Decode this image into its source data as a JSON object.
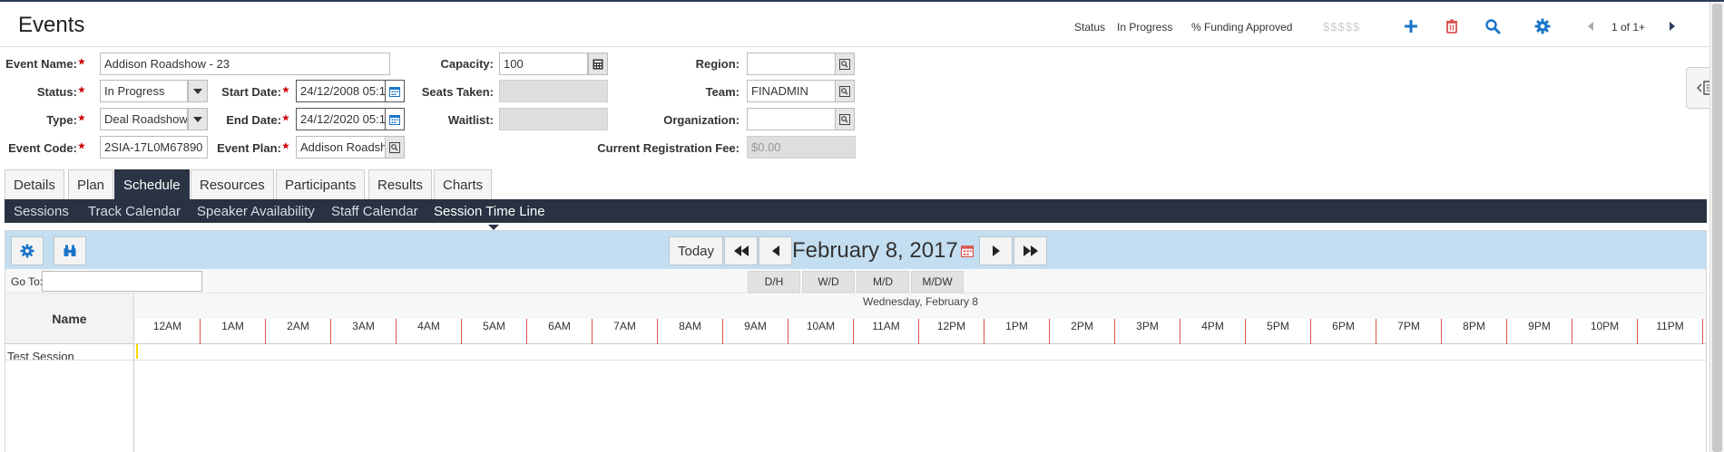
{
  "header": {
    "title": "Events",
    "status_label": "Status",
    "status_value": "In Progress",
    "funding_label": "% Funding Approved",
    "funding_value": "$$$$$",
    "pager": "1 of 1+"
  },
  "form": {
    "event_name": {
      "label": "Event Name:",
      "value": "Addison Roadshow - 23"
    },
    "status": {
      "label": "Status:",
      "value": "In Progress"
    },
    "type": {
      "label": "Type:",
      "value": "Deal Roadshow"
    },
    "event_code": {
      "label": "Event Code:",
      "value": "2SIA-17L0M67890"
    },
    "start_date": {
      "label": "Start Date:",
      "value": "24/12/2008 05:1"
    },
    "end_date": {
      "label": "End Date:",
      "value": "24/12/2020 05:1"
    },
    "event_plan": {
      "label": "Event Plan:",
      "value": "Addison Roadsho"
    },
    "capacity": {
      "label": "Capacity:",
      "value": "100"
    },
    "seats_taken": {
      "label": "Seats Taken:",
      "value": ""
    },
    "waitlist": {
      "label": "Waitlist:",
      "value": ""
    },
    "current_fee": {
      "label": "Current Registration Fee:",
      "value": "$0.00"
    },
    "region": {
      "label": "Region:",
      "value": ""
    },
    "team": {
      "label": "Team:",
      "value": "FINADMIN"
    },
    "organization": {
      "label": "Organization:",
      "value": ""
    }
  },
  "tabs": [
    "Details",
    "Plan",
    "Schedule",
    "Resources",
    "Participants",
    "Results",
    "Charts"
  ],
  "active_tab": "Schedule",
  "subtabs": [
    "Sessions",
    "Track Calendar",
    "Speaker Availability",
    "Staff Calendar",
    "Session Time Line"
  ],
  "active_subtab": "Session Time Line",
  "scheduler": {
    "today_label": "Today",
    "date_title": "February 8, 2017",
    "goto_label": "Go To:",
    "goto_value": "",
    "views": [
      "D/H",
      "W/D",
      "M/D",
      "M/DW"
    ],
    "name_header": "Name",
    "day_header": "Wednesday, February 8",
    "hours": [
      "12AM",
      "1AM",
      "2AM",
      "3AM",
      "4AM",
      "5AM",
      "6AM",
      "7AM",
      "8AM",
      "9AM",
      "10AM",
      "11AM",
      "12PM",
      "1PM",
      "2PM",
      "3PM",
      "4PM",
      "5PM",
      "6PM",
      "7PM",
      "8PM",
      "9PM",
      "10PM",
      "11PM"
    ],
    "rows": [
      {
        "name": "Test Session"
      }
    ]
  },
  "colors": {
    "accent_blue": "#1a75c9",
    "delete_red": "#d9534f",
    "nav_dark": "#283242",
    "toolbar_blue": "#c3def0"
  }
}
